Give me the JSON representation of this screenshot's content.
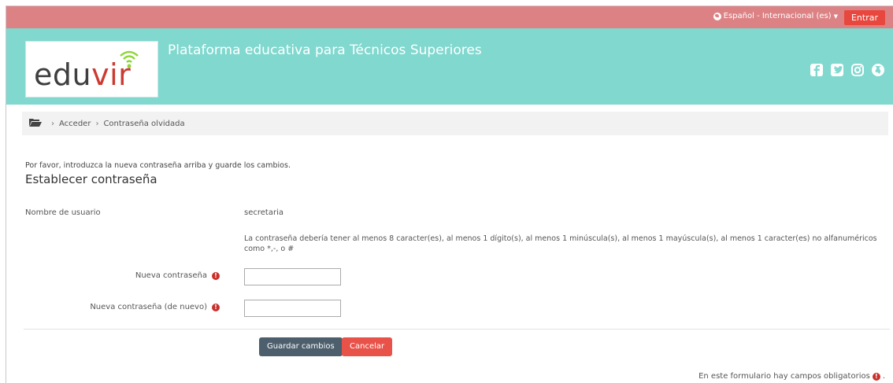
{
  "topbar": {
    "language": "Español - Internacional (es)",
    "login_button": "Entrar",
    "color": "#dc8285"
  },
  "header": {
    "logo_text_a": "edu",
    "logo_text_b": "vir",
    "site_title": "Plataforma educativa para Técnicos Superiores",
    "social_icons": [
      "facebook-icon",
      "twitter-icon",
      "instagram-icon",
      "web-icon"
    ],
    "color": "#80d8cf"
  },
  "breadcrumb": {
    "items": [
      "Acceder",
      "Contraseña olvidada"
    ]
  },
  "form": {
    "intro": "Por favor, introduzca la nueva contraseña arriba y guarde los cambios.",
    "heading": "Establecer contraseña",
    "username_label": "Nombre de usuario",
    "username_value": "secretaria",
    "policy": "La contraseña debería tener al menos 8 caracter(es), al menos 1 dígito(s), al menos 1 minúscula(s), al menos 1 mayúscula(s), al menos 1 caracter(es) no alfanuméricos como *,-, o #",
    "new_password_label": "Nueva contraseña",
    "new_password_value": "",
    "new_password_again_label": "Nueva contraseña (de nuevo)",
    "new_password_again_value": "",
    "save_button": "Guardar cambios",
    "cancel_button": "Cancelar",
    "required_note": "En este formulario hay campos obligatorios"
  }
}
